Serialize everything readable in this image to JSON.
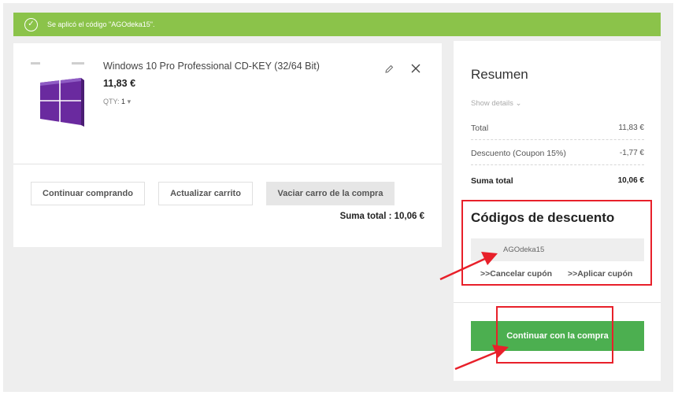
{
  "notice": {
    "text": "Se aplicó el código \"AGOdeka15\"."
  },
  "cart": {
    "item": {
      "name": "Windows 10 Pro Professional CD-KEY (32/64 Bit)",
      "price": "11,83 €",
      "qty_label": "QTY:",
      "qty_value": "1"
    },
    "buttons": {
      "continue": "Continuar comprando",
      "update": "Actualizar carrito",
      "empty": "Vaciar carro de la compra"
    },
    "total_label": "Suma total :",
    "total_value": "10,06 €"
  },
  "summary": {
    "title": "Resumen",
    "show_details": "Show details",
    "rows": [
      {
        "label": "Total",
        "value": "11,83 €"
      },
      {
        "label": "Descuento (Coupon 15%)",
        "value": "-1,77 €"
      },
      {
        "label": "Suma total",
        "value": "10,06 €"
      }
    ],
    "discount_title": "Códigos de descuento",
    "coupon_value": "AGOdeka15",
    "cancel_link": "Cancelar cupón",
    "apply_link": "Aplicar cupón",
    "checkout": "Continuar con la compra"
  },
  "colors": {
    "notice_bg": "#8bc34a",
    "checkout_bg": "#4caf50",
    "annotation": "#e8202a",
    "windows_purple": "#6a2a9f"
  },
  "icons": [
    "check-circle-icon",
    "pencil-icon",
    "close-icon",
    "chevron-down-icon",
    "double-chevron-right-icon"
  ]
}
